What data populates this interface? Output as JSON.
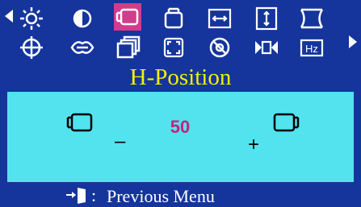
{
  "osd": {
    "title": "H-Position",
    "icons": [
      {
        "name": "brightness-icon",
        "selected": false
      },
      {
        "name": "contrast-icon",
        "selected": false
      },
      {
        "name": "h-position-icon",
        "selected": true
      },
      {
        "name": "v-position-icon",
        "selected": false
      },
      {
        "name": "h-size-icon",
        "selected": false
      },
      {
        "name": "v-size-icon",
        "selected": false
      },
      {
        "name": "pincushion-icon",
        "selected": false
      },
      {
        "name": "rotation-icon",
        "selected": false
      },
      {
        "name": "trapezoid-icon",
        "selected": false
      },
      {
        "name": "recall-icon",
        "selected": false
      },
      {
        "name": "zoom-icon",
        "selected": false
      },
      {
        "name": "degauss-icon",
        "selected": false
      },
      {
        "name": "moire-icon",
        "selected": false
      },
      {
        "name": "hz-info-icon",
        "selected": false
      }
    ],
    "adjust": {
      "value": "50",
      "minus": "–",
      "plus": "+"
    },
    "footer": {
      "colon": ":",
      "label": "Previous Menu"
    },
    "colors": {
      "background": "#15359c",
      "panel": "#53e3ee",
      "title": "#f2f201",
      "selected": "#d23c8a",
      "value": "#c4237f"
    }
  }
}
